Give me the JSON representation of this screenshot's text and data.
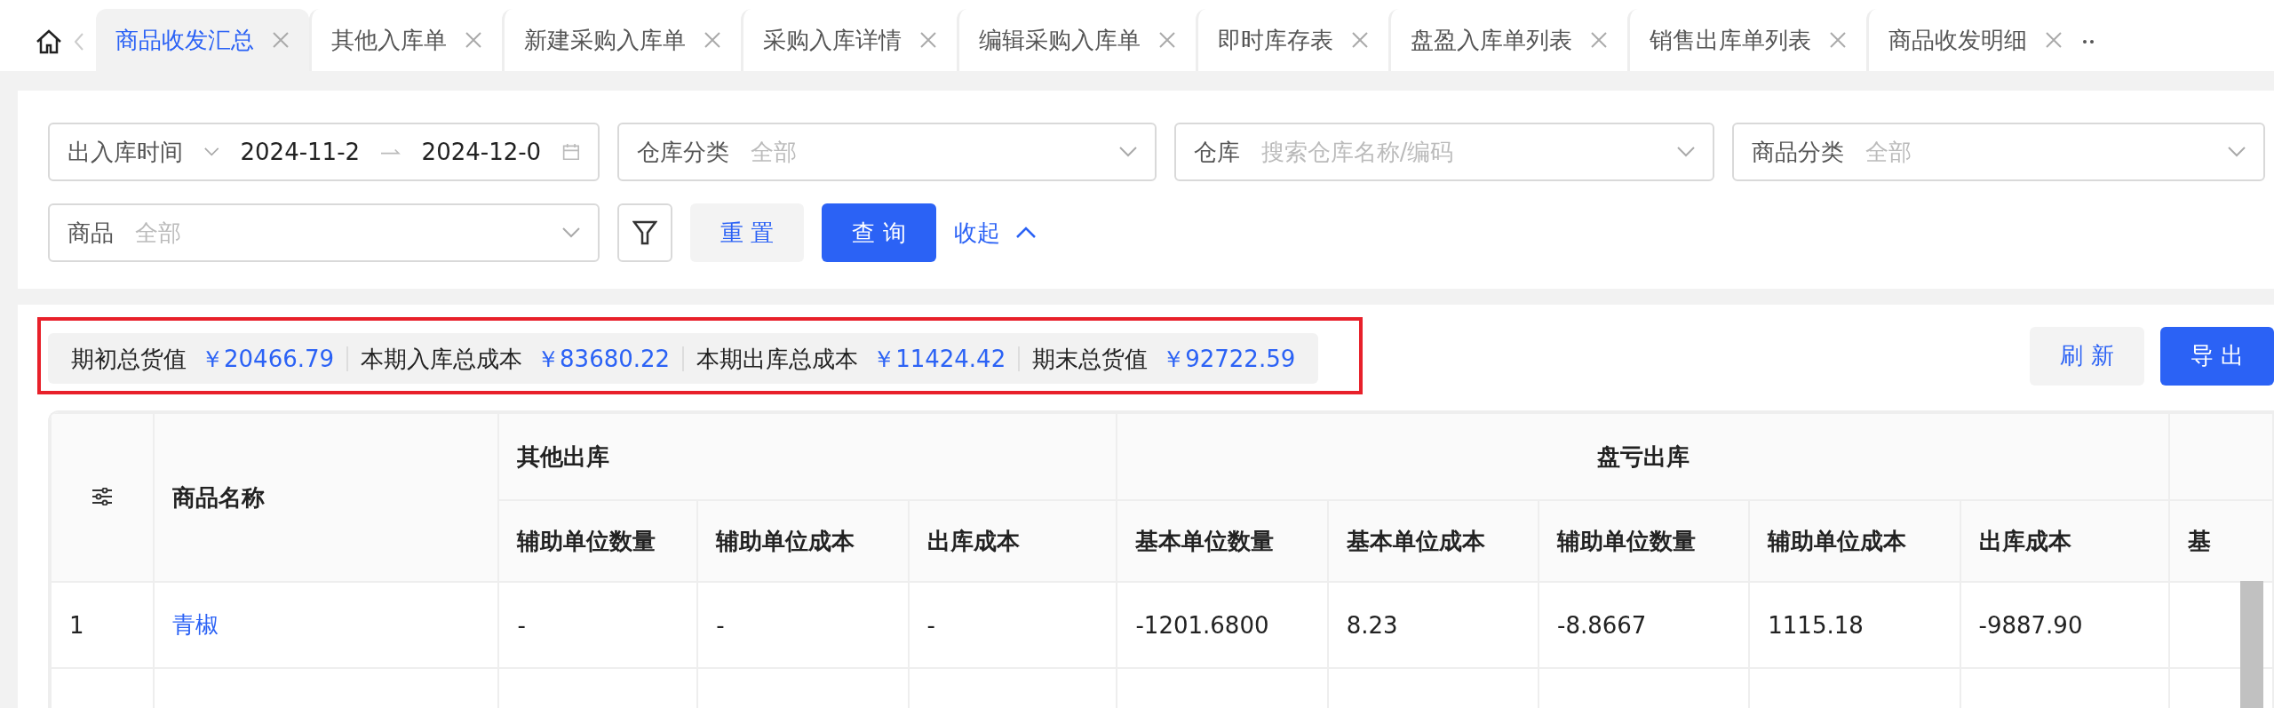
{
  "tabs": [
    {
      "label": "商品收发汇总",
      "selected": true
    },
    {
      "label": "其他入库单",
      "selected": false
    },
    {
      "label": "新建采购入库单",
      "selected": false
    },
    {
      "label": "采购入库详情",
      "selected": false
    },
    {
      "label": "编辑采购入库单",
      "selected": false
    },
    {
      "label": "即时库存表",
      "selected": false
    },
    {
      "label": "盘盈入库单列表",
      "selected": false
    },
    {
      "label": "销售出库单列表",
      "selected": false
    },
    {
      "label": "商品收发明细",
      "selected": false
    }
  ],
  "filters": [
    {
      "kind": "daterange",
      "label": "出入库时间",
      "start": "2024-11-2",
      "end": "2024-12-0"
    },
    {
      "kind": "select",
      "label": "仓库分类",
      "placeholder": "全部"
    },
    {
      "kind": "select",
      "label": "仓库",
      "placeholder": "搜索仓库名称/编码"
    },
    {
      "kind": "select",
      "label": "商品分类",
      "placeholder": "全部"
    },
    {
      "kind": "select",
      "label": "商品",
      "placeholder": "全部"
    }
  ],
  "filter_buttons": [
    {
      "kind": "secondary",
      "label": "重 置"
    },
    {
      "kind": "primary",
      "label": "查 询"
    }
  ],
  "collapse_link": "收起",
  "summary": {
    "highlighted": true,
    "items": [
      {
        "label": "期初总货值",
        "value": "￥20466.79"
      },
      {
        "label": "本期入库总成本",
        "value": "￥83680.22"
      },
      {
        "label": "本期出库总成本",
        "value": "￥11424.42"
      },
      {
        "label": "期末总货值",
        "value": "￥92722.59"
      }
    ]
  },
  "actions": [
    {
      "kind": "secondary",
      "label": "刷 新"
    },
    {
      "kind": "primary",
      "label": "导 出"
    }
  ],
  "table": {
    "name_header": "商品名称",
    "groups": [
      {
        "title": "其他出库",
        "columns": [
          "辅助单位数量",
          "辅助单位成本",
          "出库成本"
        ]
      },
      {
        "title": "盘亏出库",
        "columns": [
          "基本单位数量",
          "基本单位成本",
          "辅助单位数量",
          "辅助单位成本",
          "出库成本"
        ]
      }
    ],
    "cut_column": "基",
    "rows": [
      {
        "index": "1",
        "name": "青椒",
        "cells": [
          "-",
          "-",
          "-",
          "-1201.6800",
          "8.23",
          "-8.8667",
          "1115.18",
          "-9887.90"
        ]
      }
    ]
  }
}
